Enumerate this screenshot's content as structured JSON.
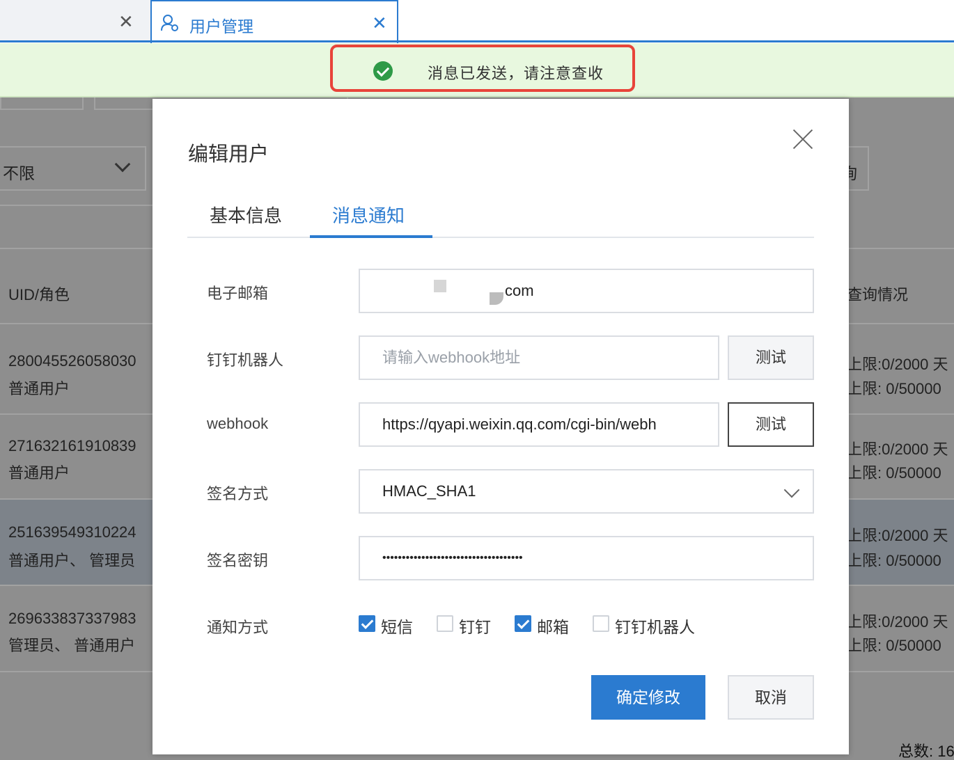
{
  "tabs": {
    "active_label": "用户管理"
  },
  "toast": {
    "message": "消息已发送，请注意查收"
  },
  "background": {
    "filter_value": "不限",
    "right_button_fragment": "询",
    "col_uid_role": "UID/角色",
    "col_query": "查询情况",
    "rows": [
      {
        "uid": "280045526058030",
        "role": "普通用户",
        "q1": "上限:0/2000 天",
        "q2": "上限: 0/50000"
      },
      {
        "uid": "271632161910839",
        "role": "普通用户",
        "q1": "上限:0/2000 天",
        "q2": "上限: 0/50000"
      },
      {
        "uid": "251639549310224",
        "role": "普通用户、 管理员",
        "q1": "上限:0/2000 天",
        "q2": "上限: 0/50000"
      },
      {
        "uid": "269633837337983",
        "role": "管理员、 普通用户",
        "q1": "上限:0/2000 天",
        "q2": "上限: 0/50000"
      }
    ],
    "total": "总数: 16"
  },
  "modal": {
    "title": "编辑用户",
    "tabs": {
      "basic": "基本信息",
      "notify": "消息通知"
    },
    "fields": {
      "email": {
        "label": "电子邮箱",
        "value_suffix": "com"
      },
      "dingtalk_robot": {
        "label": "钉钉机器人",
        "placeholder": "请输入webhook地址",
        "test_label": "测试"
      },
      "webhook": {
        "label": "webhook",
        "value": "https://qyapi.weixin.qq.com/cgi-bin/webh",
        "test_label": "测试"
      },
      "sign_method": {
        "label": "签名方式",
        "value": "HMAC_SHA1"
      },
      "sign_secret": {
        "label": "签名密钥",
        "value": "••••••••••••••••••••••••••••••••••••"
      },
      "notify_method": {
        "label": "通知方式",
        "options": [
          {
            "label": "短信",
            "checked": true
          },
          {
            "label": "钉钉",
            "checked": false
          },
          {
            "label": "邮箱",
            "checked": true
          },
          {
            "label": "钉钉机器人",
            "checked": false
          }
        ]
      }
    },
    "buttons": {
      "confirm": "确定修改",
      "cancel": "取消"
    }
  }
}
